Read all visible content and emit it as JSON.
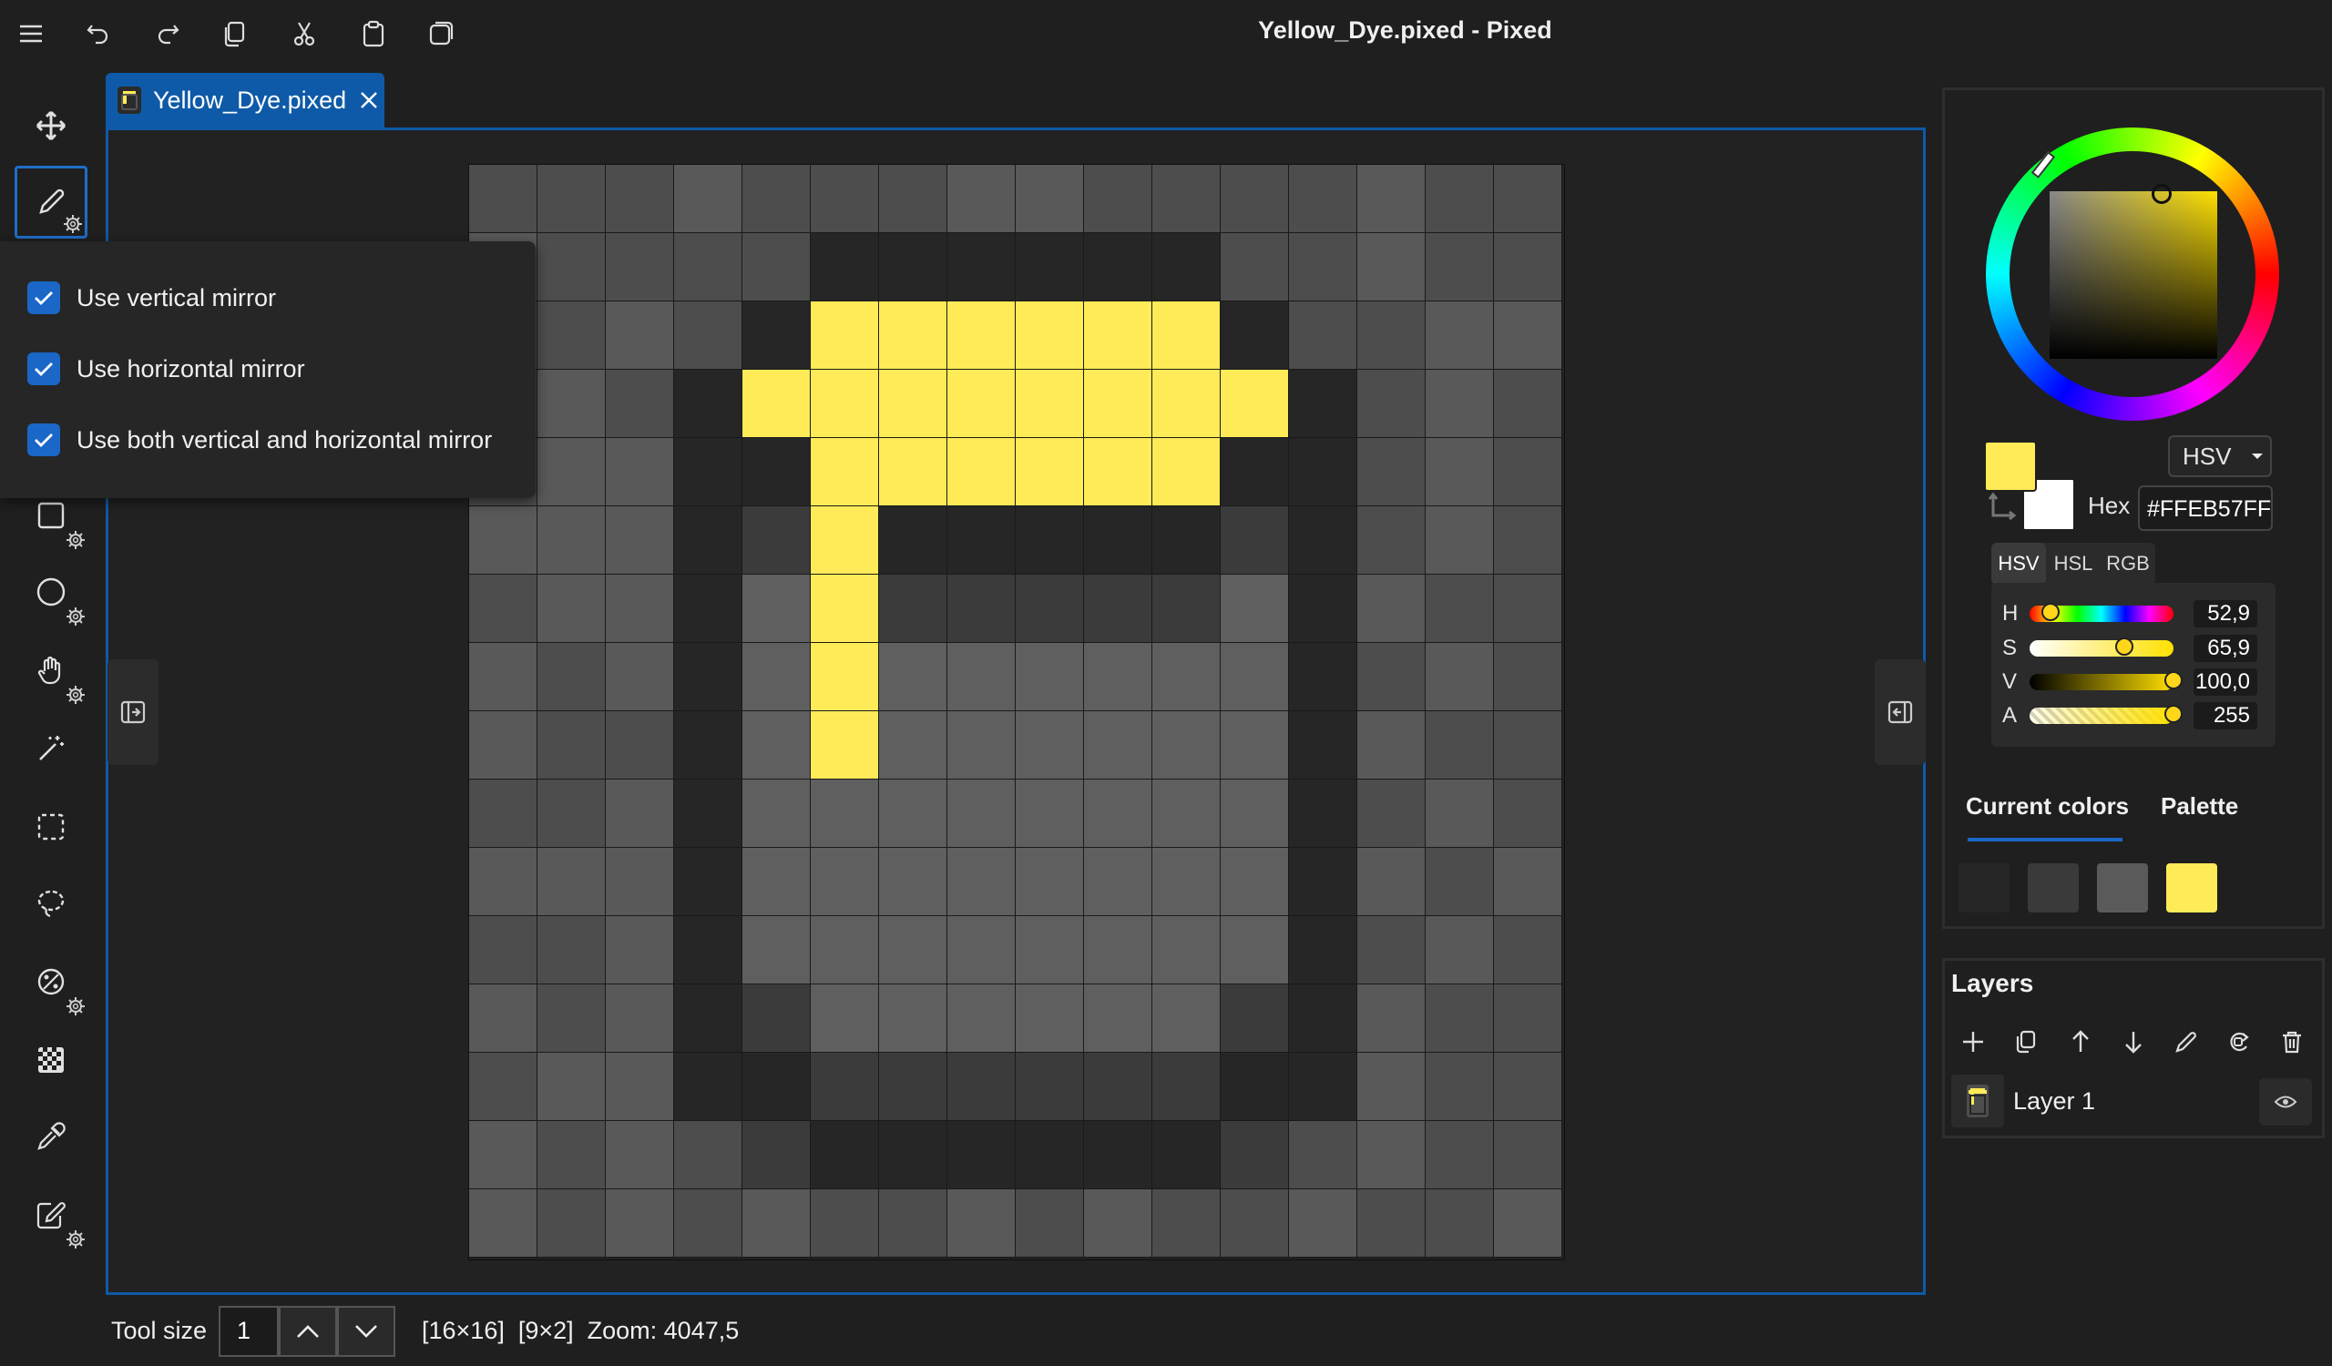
{
  "window": {
    "title": "Yellow_Dye.pixed - Pixed"
  },
  "toolbar": {
    "icons": [
      "menu-icon",
      "undo-icon",
      "redo-icon",
      "copy-icon",
      "cut-icon",
      "paste-icon",
      "duplicate-icon"
    ]
  },
  "tab": {
    "label": "Yellow_Dye.pixed"
  },
  "mirror_popup": {
    "options": [
      {
        "label": "Use vertical mirror",
        "checked": true
      },
      {
        "label": "Use horizontal mirror",
        "checked": true
      },
      {
        "label": "Use both vertical and horizontal mirror",
        "checked": true
      }
    ]
  },
  "status": {
    "tool_size_label": "Tool size",
    "tool_size_value": "1",
    "info": "[16×16]  [9×2]  Zoom: 4047,5"
  },
  "color_picker": {
    "mode": "HSV",
    "hex_label": "Hex",
    "hex_value": "#FFEB57FF",
    "primary_color": "#FFEB57",
    "secondary_color": "#FFFFFF",
    "model_tabs": [
      "HSV",
      "HSL",
      "RGB"
    ],
    "sliders": [
      {
        "name": "H",
        "value": "52,9",
        "fraction": 0.147
      },
      {
        "name": "S",
        "value": "65,9",
        "fraction": 0.659
      },
      {
        "name": "V",
        "value": "100,0",
        "fraction": 1.0
      },
      {
        "name": "A",
        "value": "255",
        "fraction": 1.0
      }
    ]
  },
  "colors_panel": {
    "tabs": [
      "Current colors",
      "Palette"
    ],
    "current_colors": [
      "#262626",
      "#3a3a3a",
      "#5a5a5a",
      "#FFEB57"
    ]
  },
  "layers": {
    "title": "Layers",
    "items": [
      {
        "name": "Layer 1"
      }
    ]
  },
  "pixel_art": {
    "palette": {
      "0": "#262626",
      "1": "#3b3b3b",
      "2": "#4d4d4d",
      "3": "#595959",
      "4": "#5f5f5f",
      "5": "#FFEB57"
    },
    "rows": [
      "2223222332222322",
      "3222200000022322",
      "3232055555502233",
      "2320555555550232",
      "2330055555500232",
      "3330150000010232",
      "2330451111140322",
      "3230454444440232",
      "3220454444440322",
      "2230444444440232",
      "3330444444440323",
      "2230444444440232",
      "3230144444410322",
      "2330011111100322",
      "3232100000012322",
      "3232322323223223"
    ]
  }
}
